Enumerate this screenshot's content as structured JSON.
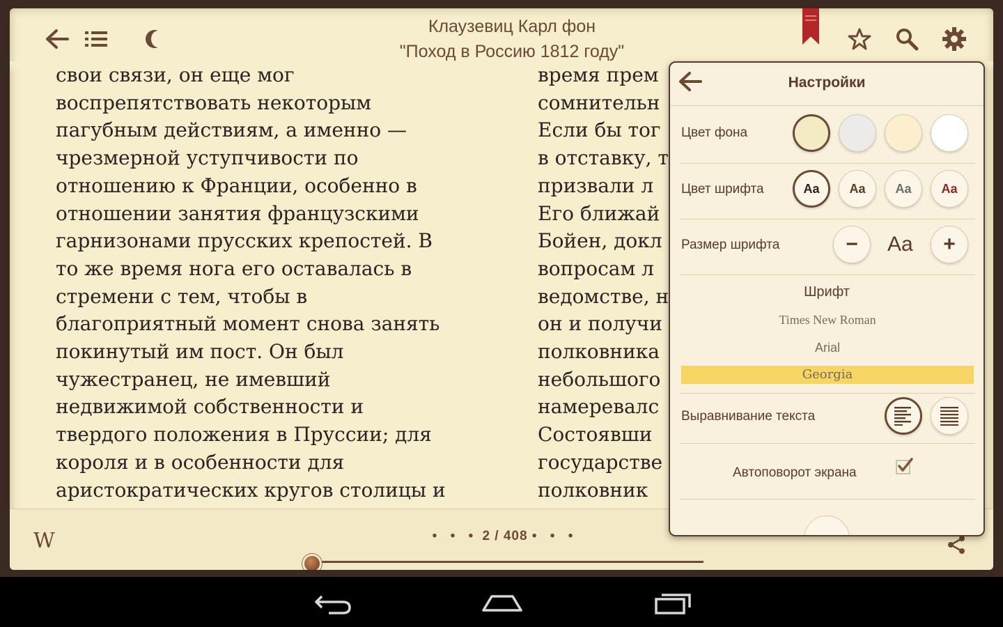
{
  "header": {
    "author": "Клаузевиц Карл фон",
    "title": "\"Поход в Россию 1812 году\"",
    "icons": [
      "back-arrow-icon",
      "contents-list-icon",
      "night-mode-moon-icon",
      "bookmark-ribbon-icon",
      "star-icon",
      "search-icon",
      "gear-icon"
    ]
  },
  "reader": {
    "left_column": [
      "свои связи, он еще мог",
      "воспрепятствовать некоторым",
      "пагубным действиям, а именно —",
      "чрезмерной уступчивости по",
      "отношению к Франции, особенно в",
      "отношении занятия французскими",
      "гарнизонами прусских крепостей. В",
      "то же время нога его оставалась в",
      "стремени с тем, чтобы в",
      "благоприятный момент снова занять",
      "покинутый им пост. Он был",
      "чужестранец, не имевший",
      "недвижимой собственности и",
      "твердого положения в Пруссии; для",
      "короля и в особенности для",
      "аристократических кругов столицы и"
    ],
    "right_column": [
      "время прем",
      "сомнительн",
      "Если бы тог",
      "в отставку, т",
      "призвали л",
      "Его ближай",
      "Бойен, докл",
      "вопросам л",
      "ведомстве, н",
      "он и получи",
      "полковника",
      "небольшого",
      "намеревалс",
      "Состоявши",
      "государстве",
      "полковник"
    ]
  },
  "footer": {
    "wiki_label": "W",
    "dots": "• • •",
    "page": "2 / 408",
    "progress_fraction": 0.0049
  },
  "settings": {
    "title": "Настройки",
    "bg_color_label": "Цвет фона",
    "bg_colors": [
      "#f4ebc6",
      "#ecebea",
      "#fbefcd",
      "#ffffff"
    ],
    "font_color_label": "Цвет шрифта",
    "font_color_sample": "Aa",
    "font_colors": [
      "#2b2320",
      "#5a3a28",
      "#6d6d6d",
      "#8a2a20"
    ],
    "font_size_label": "Размер шрифта",
    "font_size_minus": "−",
    "font_size_sample": "Aa",
    "font_size_plus": "+",
    "font_heading": "Шрифт",
    "fonts": [
      "Times New Roman",
      "Arial",
      "Georgia"
    ],
    "selected_font": "Georgia",
    "align_label": "Выравнивание текста",
    "autorotate_label": "Автоповорот экрана",
    "autorotate_checked": true
  },
  "navbar": {
    "icons": [
      "back-nav-icon",
      "home-nav-icon",
      "recent-apps-icon"
    ]
  }
}
